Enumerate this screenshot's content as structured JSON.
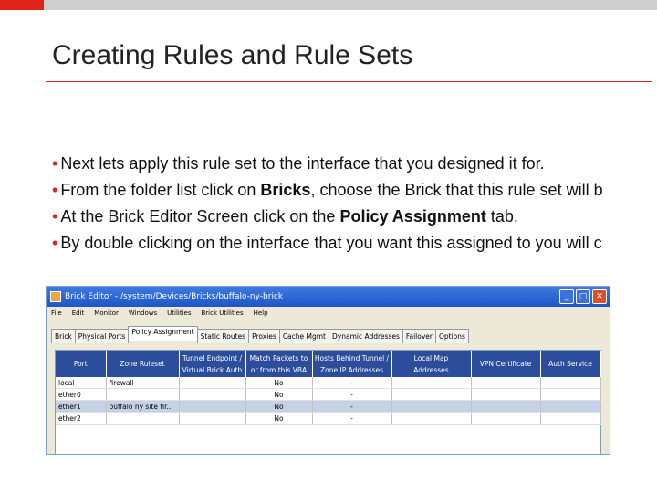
{
  "slide": {
    "title": "Creating Rules and Rule Sets",
    "bullets": [
      {
        "pre": "Next lets apply this rule set to the interface that you designed it for.",
        "bold": "",
        "post": ""
      },
      {
        "pre": "From the folder list click on ",
        "bold": "Bricks",
        "post": ", choose the Brick that this rule set will b"
      },
      {
        "pre": "At the Brick Editor Screen click on the ",
        "bold": "Policy Assignment",
        "post": " tab."
      },
      {
        "pre": "By double clicking on the interface that you want this assigned to you will c",
        "bold": "",
        "post": ""
      }
    ],
    "bullet_char": "•"
  },
  "window": {
    "title": "Brick Editor - /system/Devices/Bricks/buffalo-ny-brick",
    "menu": [
      "File",
      "Edit",
      "Monitor",
      "Windows",
      "Utilities",
      "Brick Utilities",
      "Help"
    ],
    "tabs": [
      "Brick",
      "Physical Ports",
      "Policy Assignment",
      "Static Routes",
      "Proxies",
      "Cache Mgmt",
      "Dynamic Addresses",
      "Failover",
      "Options"
    ],
    "active_tab": 2,
    "columns": [
      {
        "l1": "Port",
        "l2": ""
      },
      {
        "l1": "Zone Ruleset",
        "l2": ""
      },
      {
        "l1": "Tunnel Endpoint /",
        "l2": "Virtual Brick Auth"
      },
      {
        "l1": "Match Packets to",
        "l2": "or from this VBA"
      },
      {
        "l1": "Hosts Behind Tunnel /",
        "l2": "Zone IP Addresses"
      },
      {
        "l1": "Local Map",
        "l2": "Addresses"
      },
      {
        "l1": "VPN Certificate",
        "l2": ""
      },
      {
        "l1": "Auth Service",
        "l2": ""
      }
    ],
    "rows": [
      [
        "local",
        "firewall",
        "",
        "No",
        "-",
        "",
        "",
        ""
      ],
      [
        "ether0",
        "",
        "",
        "No",
        "-",
        "",
        "",
        ""
      ],
      [
        "ether1",
        "buffalo ny site fir...",
        "",
        "No",
        "-",
        "",
        "",
        ""
      ],
      [
        "ether2",
        "",
        "",
        "No",
        "-",
        "",
        "",
        ""
      ]
    ],
    "selected_row": 2
  },
  "colors": {
    "accent": "#e2231a",
    "header_blue": "#2b4d9c",
    "title_blue": "#1f55c7"
  }
}
